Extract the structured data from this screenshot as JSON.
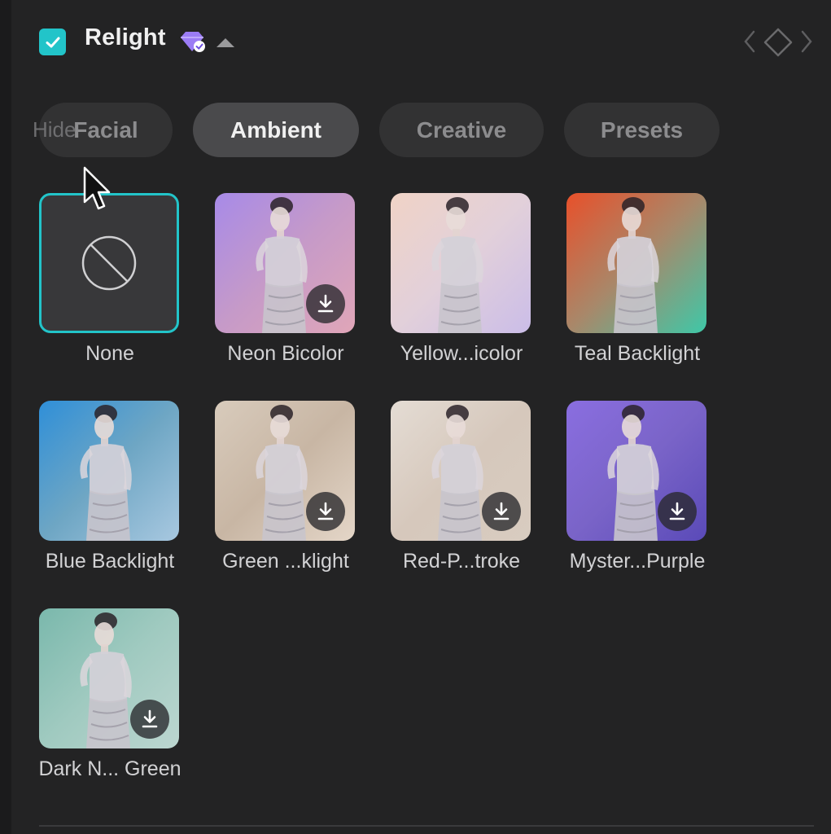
{
  "header": {
    "title": "Relight",
    "enabled": true,
    "icons": {
      "checkbox": "check-icon",
      "premium": "diamond-badge-icon",
      "collapse": "triangle-up-icon",
      "prev_keyframe": "chevron-left-icon",
      "keyframe": "diamond-keyframe-icon",
      "next_keyframe": "chevron-right-icon"
    }
  },
  "tabs": {
    "overlay_text": "Hide",
    "items": [
      {
        "label": "Facial",
        "active": false
      },
      {
        "label": "Ambient",
        "active": true
      },
      {
        "label": "Creative",
        "active": false
      },
      {
        "label": "Presets",
        "active": false
      }
    ]
  },
  "presets": [
    {
      "label": "None",
      "selected": true,
      "download": false,
      "colors": []
    },
    {
      "label": "Neon Bicolor",
      "download": true,
      "colors": [
        "#a78ae8",
        "#c69ac8",
        "#e0a6b8"
      ]
    },
    {
      "label": "Yellow...icolor",
      "download": false,
      "colors": [
        "#f0d3c6",
        "#e2d0da",
        "#cbbde8"
      ]
    },
    {
      "label": "Teal Backlight",
      "download": false,
      "colors": [
        "#e8502a",
        "#a8886a",
        "#3ec8a8"
      ]
    },
    {
      "label": "Blue Backlight",
      "download": false,
      "colors": [
        "#2f8fd8",
        "#6ea6c4",
        "#a8c8e0"
      ]
    },
    {
      "label": "Green ...klight",
      "download": true,
      "colors": [
        "#d8cbbc",
        "#c8b6a4",
        "#e4d6c8"
      ]
    },
    {
      "label": "Red-P...troke",
      "download": true,
      "colors": [
        "#e4dcd4",
        "#d6c8bc",
        "#d8ccc0"
      ]
    },
    {
      "label": "Myster...Purple",
      "download": true,
      "colors": [
        "#8a6ee0",
        "#7a64c8",
        "#5a4ab8"
      ]
    },
    {
      "label": "Dark N... Green",
      "download": true,
      "colors": [
        "#7ab8ac",
        "#a0cac0",
        "#bcd6d0"
      ]
    }
  ],
  "colors": {
    "accent": "#22c4c9",
    "premium": "#9b7cf5",
    "background": "#232324"
  }
}
